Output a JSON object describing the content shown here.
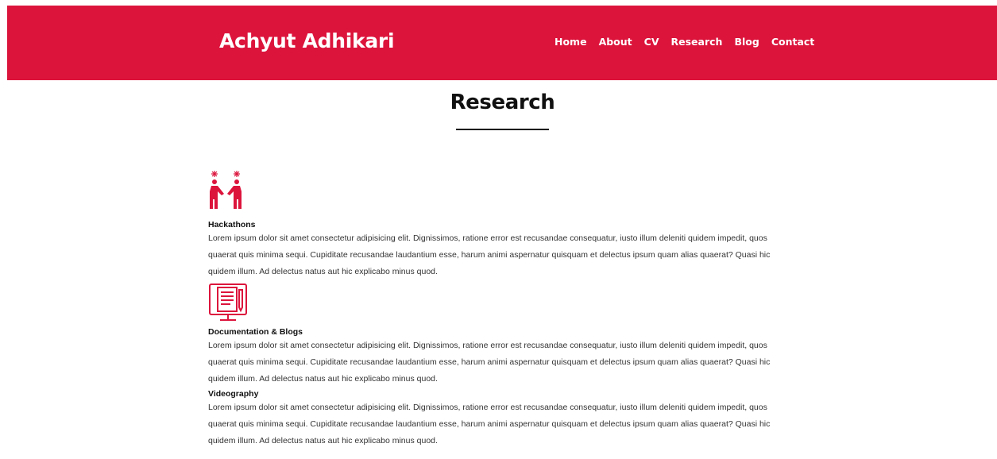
{
  "brand": {
    "name": "Achyut Adhikari"
  },
  "nav": {
    "items": [
      {
        "label": "Home"
      },
      {
        "label": "About"
      },
      {
        "label": "CV"
      },
      {
        "label": "Research"
      },
      {
        "label": "Blog"
      },
      {
        "label": "Contact"
      }
    ]
  },
  "page": {
    "title": "Research"
  },
  "colors": {
    "accent": "#dc143c",
    "text": "#222222"
  },
  "sections": [
    {
      "icon": "hackathon-people-icon",
      "heading": "Hackathons",
      "text": "Lorem ipsum dolor sit amet consectetur adipisicing elit. Dignissimos, ratione error est recusandae consequatur, iusto illum deleniti quidem impedit, quos quaerat quis minima sequi. Cupiditate recusandae laudantium esse, harum animi aspernatur quisquam et delectus ipsum quam alias quaerat? Quasi hic quidem illum. Ad delectus natus aut hic explicabo minus quod."
    },
    {
      "icon": "document-monitor-icon",
      "heading": "Documentation & Blogs",
      "text": "Lorem ipsum dolor sit amet consectetur adipisicing elit. Dignissimos, ratione error est recusandae consequatur, iusto illum deleniti quidem impedit, quos quaerat quis minima sequi. Cupiditate recusandae laudantium esse, harum animi aspernatur quisquam et delectus ipsum quam alias quaerat? Quasi hic quidem illum. Ad delectus natus aut hic explicabo minus quod."
    },
    {
      "heading": "Videography",
      "text": "Lorem ipsum dolor sit amet consectetur adipisicing elit. Dignissimos, ratione error est recusandae consequatur, iusto illum deleniti quidem impedit, quos quaerat quis minima sequi. Cupiditate recusandae laudantium esse, harum animi aspernatur quisquam et delectus ipsum quam alias quaerat? Quasi hic quidem illum. Ad delectus natus aut hic explicabo minus quod."
    }
  ]
}
